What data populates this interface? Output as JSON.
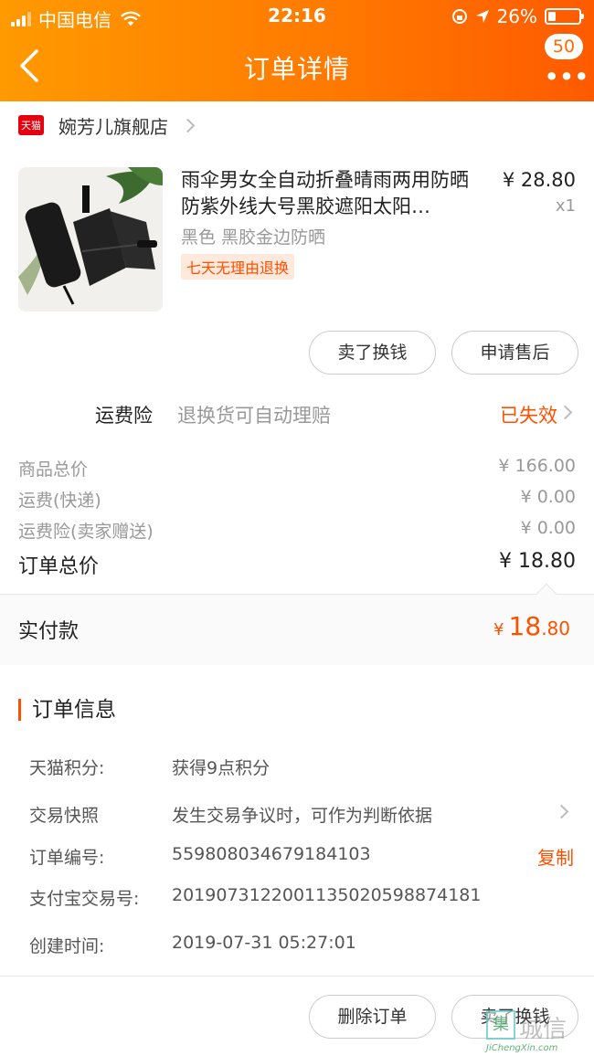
{
  "status_bar": {
    "carrier": "中国电信",
    "time": "22:16",
    "battery": "26%",
    "battery_level": 0.26
  },
  "header": {
    "title": "订单详情",
    "badge": "50"
  },
  "store": {
    "logo_text": "天猫",
    "name": "婉芳儿旗舰店"
  },
  "product": {
    "title": "雨伞男女全自动折叠晴雨两用防晒防紫外线大号黑胶遮阳太阳…",
    "price": "¥ 28.80",
    "quantity": "x1",
    "sku": "黑色 黑胶金边防晒",
    "tag": "七天无理由退换"
  },
  "actions": {
    "sell": "卖了换钱",
    "after_sale": "申请售后",
    "delete": "删除订单"
  },
  "insurance": {
    "label": "运费险",
    "desc": "退换货可自动理赔",
    "status": "已失效"
  },
  "summary": {
    "rows": [
      {
        "label": "商品总价",
        "value": "¥ 166.00"
      },
      {
        "label": "运费(快递)",
        "value": "¥ 0.00"
      },
      {
        "label": "运费险(卖家赠送)",
        "value": "¥ 0.00"
      }
    ],
    "total_label": "订单总价",
    "total_value": "¥ 18.80"
  },
  "payment": {
    "label": "实付款",
    "currency": "¥",
    "integer": "18",
    "decimal": ".80"
  },
  "order_info": {
    "title": "订单信息",
    "points_label": "天猫积分:",
    "points_value": "获得9点积分",
    "snapshot_label": "交易快照",
    "snapshot_value": "发生交易争议时，可作为判断依据",
    "order_no_label": "订单编号:",
    "order_no_value": "559808034679184103",
    "copy": "复制",
    "alipay_label": "支付宝交易号:",
    "alipay_value": "2019073122001135020598874181",
    "created_label": "创建时间:",
    "created_value": "2019-07-31 05:27:01"
  },
  "watermark": {
    "logo": "集",
    "text": "城信",
    "sub": "JiChengXin.com"
  },
  "colors": {
    "accent": "#ff5000",
    "header_start": "#ff9a00",
    "header_end": "#ff5a00"
  }
}
